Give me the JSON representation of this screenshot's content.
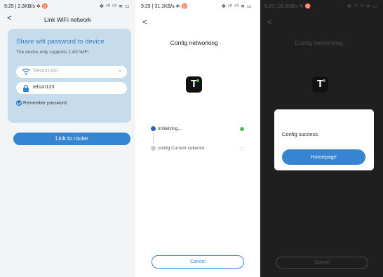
{
  "screen1": {
    "status": {
      "time": "9:25 | 2.3KB/s ✲ ♉",
      "icons": "✻ ⁵ᴵˡ ⁵ᴵˡ ≋ ▭"
    },
    "back": "<",
    "title": "Link WiFi network",
    "card": {
      "heading": "Share wifi password to device",
      "note": "The device only supports 2.4G WiFi",
      "ssid": "Telson1310",
      "ssid_chevron": ">",
      "password": "telson123",
      "remember_label": "Remember password"
    },
    "link_button": "Link to router"
  },
  "screen2": {
    "status": {
      "time": "9:25 | 31.1KB/s ✲ ♉",
      "icons": "✻ ⁵ᴵˡ ⁵ᴵˡ ≋ ▭"
    },
    "back": "<",
    "title": "Config networking",
    "title_dots": "···",
    "logo_letter": "T",
    "steps": [
      "Initializing...",
      "config Current collector"
    ],
    "cancel_button": "Cancel"
  },
  "screen3": {
    "status": {
      "time": "9:25 | 29.9KB/s ✲ ♉",
      "icons": "✻ ⁵ᴵˡ ⁵ᴵˡ ≋ ▭"
    },
    "back": "<",
    "title": "Config networking",
    "title_dots": "···",
    "logo_letter": "T",
    "dialog": {
      "message": "Config success.",
      "button": "Homepage"
    },
    "cancel_button": "Cancel"
  },
  "colors": {
    "accent": "#3585d2",
    "card": "#c6dcec",
    "success": "#5cb85c",
    "overlay": "#1f1f1f"
  }
}
